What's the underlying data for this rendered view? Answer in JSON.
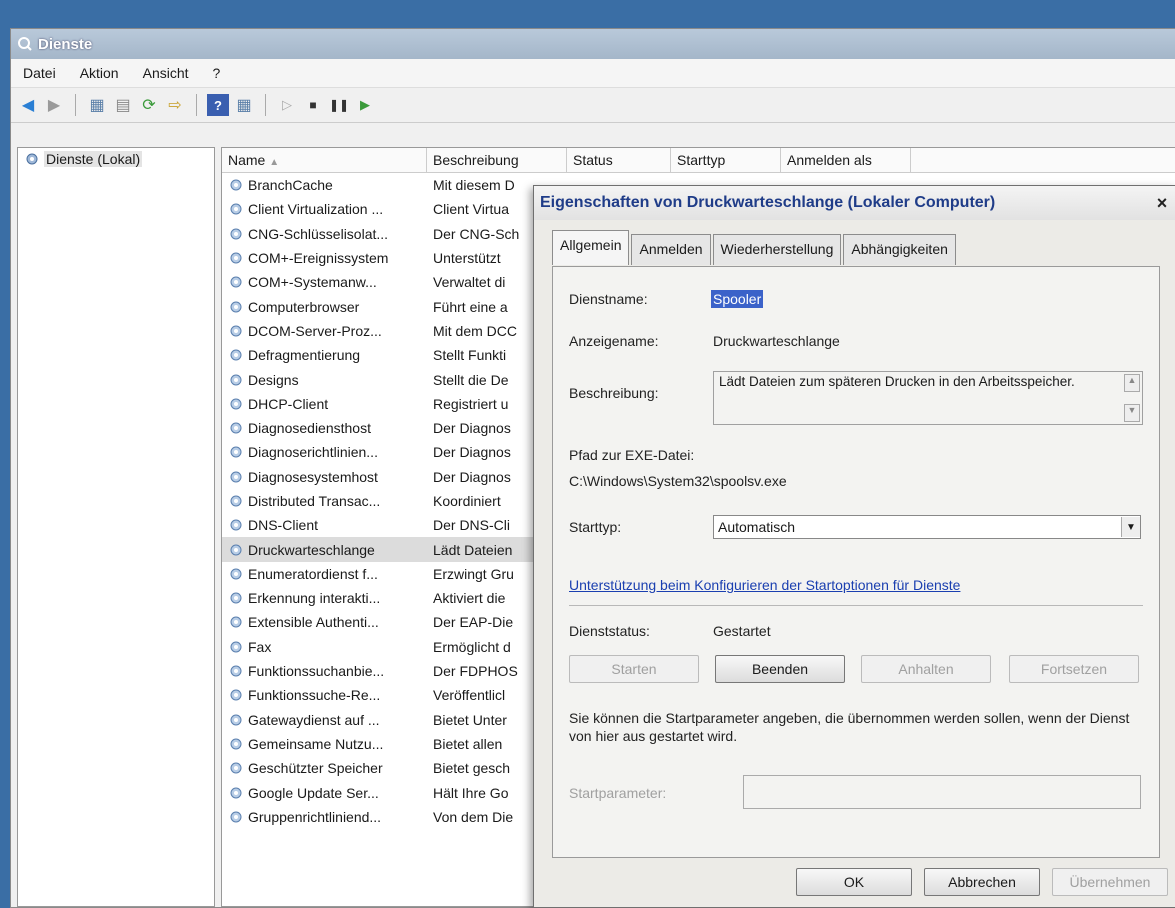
{
  "window": {
    "title": "Dienste"
  },
  "menu": [
    "Datei",
    "Aktion",
    "Ansicht",
    "?"
  ],
  "tree": {
    "root": "Dienste (Lokal)"
  },
  "list": {
    "columns": [
      "Name",
      "Beschreibung",
      "Status",
      "Starttyp",
      "Anmelden als"
    ],
    "rows": [
      {
        "name": "BranchCache",
        "desc": "Mit diesem D"
      },
      {
        "name": "Client Virtualization ...",
        "desc": "Client Virtua"
      },
      {
        "name": "CNG-Schlüsselisolat...",
        "desc": "Der CNG-Sch"
      },
      {
        "name": "COM+-Ereignissystem",
        "desc": "Unterstützt"
      },
      {
        "name": "COM+-Systemanw...",
        "desc": "Verwaltet di"
      },
      {
        "name": "Computerbrowser",
        "desc": "Führt eine a"
      },
      {
        "name": "DCOM-Server-Proz...",
        "desc": "Mit dem DCC"
      },
      {
        "name": "Defragmentierung",
        "desc": "Stellt Funkti"
      },
      {
        "name": "Designs",
        "desc": "Stellt die De"
      },
      {
        "name": "DHCP-Client",
        "desc": "Registriert u"
      },
      {
        "name": "Diagnosediensthost",
        "desc": "Der Diagnos"
      },
      {
        "name": "Diagnoserichtlinien...",
        "desc": "Der Diagnos"
      },
      {
        "name": "Diagnosesystemhost",
        "desc": "Der Diagnos"
      },
      {
        "name": "Distributed Transac...",
        "desc": "Koordiniert"
      },
      {
        "name": "DNS-Client",
        "desc": "Der DNS-Cli"
      },
      {
        "name": "Druckwarteschlange",
        "desc": "Lädt Dateien"
      },
      {
        "name": "Enumeratordienst f...",
        "desc": "Erzwingt Gru"
      },
      {
        "name": "Erkennung interakti...",
        "desc": "Aktiviert die"
      },
      {
        "name": "Extensible Authenti...",
        "desc": "Der EAP-Die"
      },
      {
        "name": "Fax",
        "desc": "Ermöglicht d"
      },
      {
        "name": "Funktionssuchanbie...",
        "desc": "Der FDPHOS"
      },
      {
        "name": "Funktionssuche-Re...",
        "desc": "Veröffentlicl"
      },
      {
        "name": "Gatewaydienst auf ...",
        "desc": "Bietet Unter"
      },
      {
        "name": "Gemeinsame Nutzu...",
        "desc": "Bietet allen"
      },
      {
        "name": "Geschützter Speicher",
        "desc": "Bietet gesch"
      },
      {
        "name": "Google Update Ser...",
        "desc": "Hält Ihre Go"
      },
      {
        "name": "Gruppenrichtliniend...",
        "desc": "Von dem Die"
      }
    ]
  },
  "dialog": {
    "title": "Eigenschaften von Druckwarteschlange (Lokaler Computer)",
    "close": "×",
    "tabs": [
      "Allgemein",
      "Anmelden",
      "Wiederherstellung",
      "Abhängigkeiten"
    ],
    "service_name_label": "Dienstname:",
    "service_name": "Spooler",
    "display_name_label": "Anzeigename:",
    "display_name": "Druckwarteschlange",
    "description_label": "Beschreibung:",
    "description": "Lädt Dateien zum späteren Drucken in den Arbeitsspeicher.",
    "path_label": "Pfad zur EXE-Datei:",
    "path": "C:\\Windows\\System32\\spoolsv.exe",
    "starttype_label": "Starttyp:",
    "starttype": "Automatisch",
    "help_link": "Unterstützung beim Konfigurieren der Startoptionen für Dienste",
    "status_label": "Dienststatus:",
    "status": "Gestartet",
    "buttons": {
      "start": "Starten",
      "stop": "Beenden",
      "pause": "Anhalten",
      "resume": "Fortsetzen"
    },
    "note": "Sie können die Startparameter angeben, die übernommen werden sollen, wenn der Dienst von hier aus gestartet wird.",
    "param_label": "Startparameter:",
    "footer": {
      "ok": "OK",
      "cancel": "Abbrechen",
      "apply": "Übernehmen"
    }
  }
}
